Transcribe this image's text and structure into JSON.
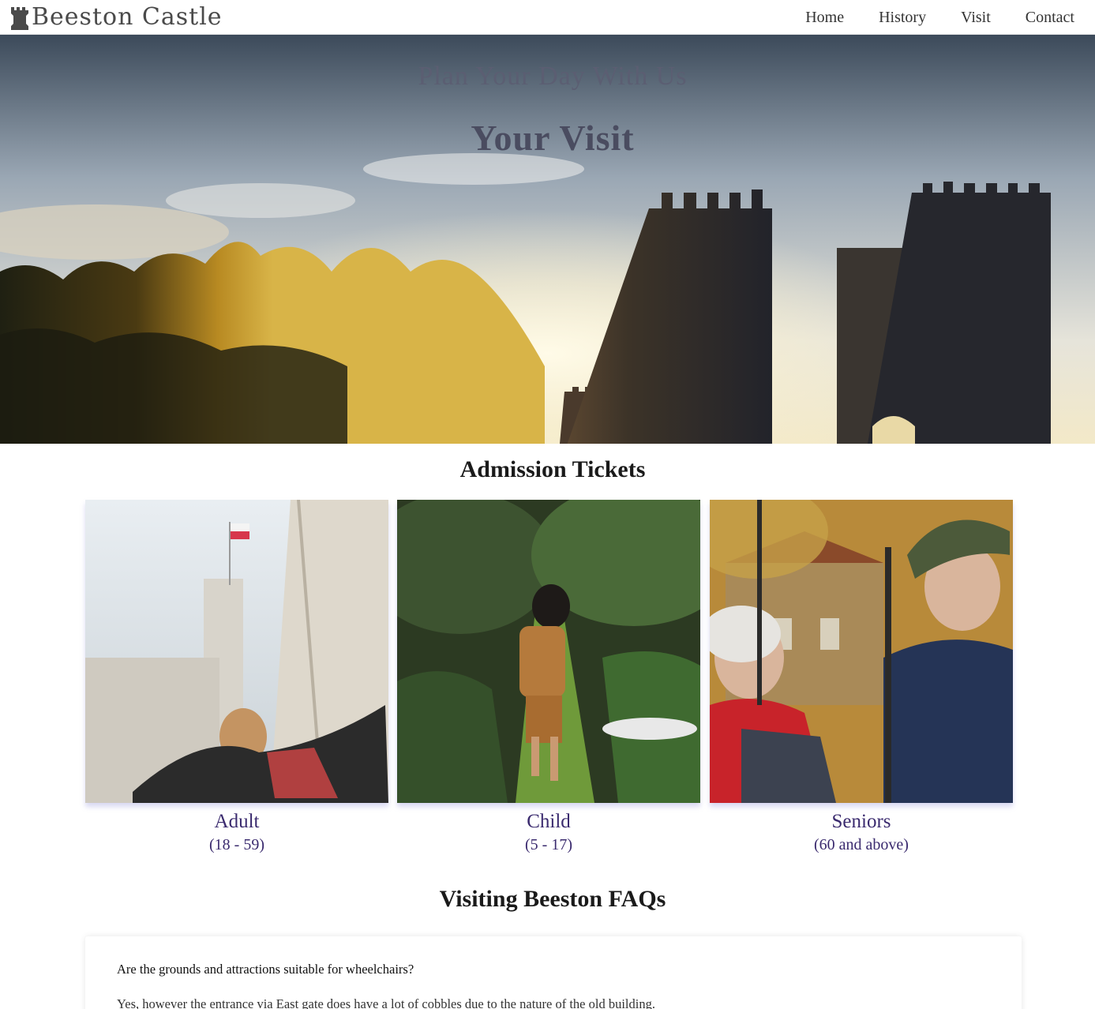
{
  "brand": {
    "name": "Beeston Castle",
    "icon": "castle-rook-icon"
  },
  "nav": {
    "items": [
      {
        "label": "Home"
      },
      {
        "label": "History"
      },
      {
        "label": "Visit"
      },
      {
        "label": "Contact"
      }
    ]
  },
  "hero": {
    "subtitle": "Plan Your Day With Us",
    "title": "Your Visit"
  },
  "tickets": {
    "heading": "Admission Tickets",
    "cards": [
      {
        "label": "Adult",
        "range": "(18 - 59)"
      },
      {
        "label": "Child",
        "range": "(5 - 17)"
      },
      {
        "label": "Seniors",
        "range": "(60 and above)"
      }
    ]
  },
  "faq": {
    "heading": "Visiting Beeston FAQs",
    "items": [
      {
        "question": "Are the grounds and attractions suitable for wheelchairs?",
        "answer": "Yes, however the entrance via East gate does have a lot of cobbles due to the nature of the old building."
      }
    ]
  },
  "colors": {
    "accent": "#3a2a6e",
    "hero_text": "#4a4c60",
    "brand_text": "#4a4a4a"
  }
}
